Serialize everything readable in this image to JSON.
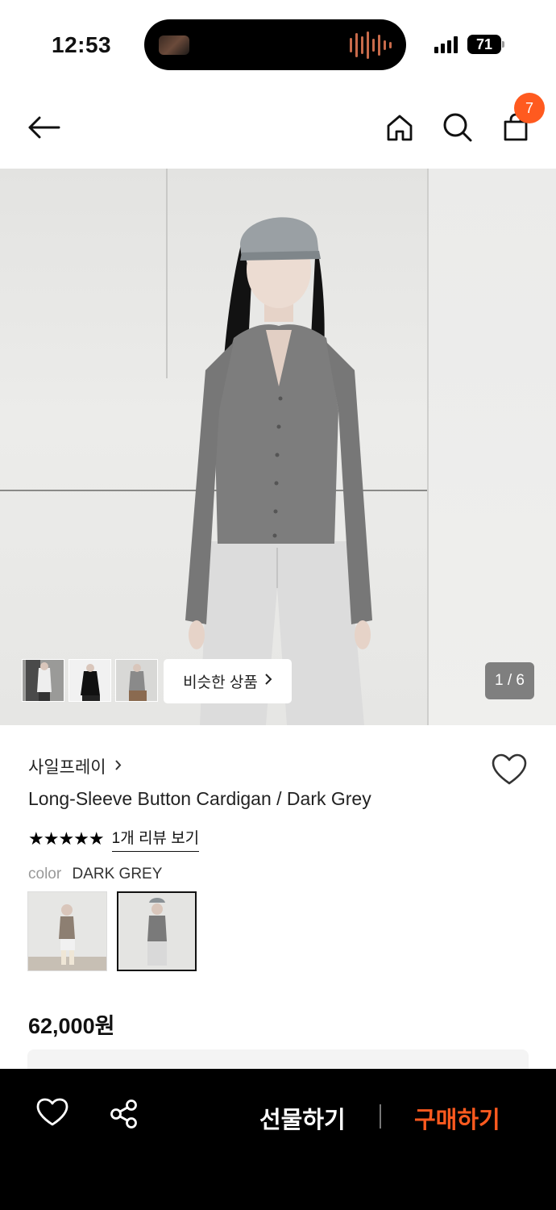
{
  "status_bar": {
    "time": "12:53",
    "battery": "71"
  },
  "header": {
    "cart_count": "7"
  },
  "hero": {
    "similar_label": "비슷한 상품",
    "page_indicator": "1 / 6"
  },
  "product": {
    "brand": "사일프레이",
    "title": "Long-Sleeve Button Cardigan / Dark Grey",
    "stars": "★★★★★",
    "review_link": "1개 리뷰 보기",
    "color_label": "color",
    "color_value": "DARK GREY",
    "price": "62,000원"
  },
  "bottom_bar": {
    "gift_label": "선물하기",
    "buy_label": "구매하기"
  },
  "colors": {
    "accent": "#ff5a1f",
    "cardigan": "#7d7d7d"
  }
}
